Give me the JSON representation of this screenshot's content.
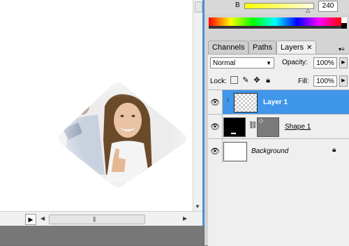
{
  "color_panel": {
    "channel_label": "B",
    "channel_value": "240",
    "colors": {
      "slider_start": "#ffff00",
      "slider_end": "#ffffe0"
    }
  },
  "tabs": [
    {
      "label": "Channels"
    },
    {
      "label": "Paths"
    },
    {
      "label": "Layers"
    }
  ],
  "tab_close": "✕",
  "layers_panel": {
    "blend_mode": "Normal",
    "opacity_label": "Opacity:",
    "opacity_value": "100%",
    "lock_label": "Lock:",
    "fill_label": "Fill:",
    "fill_value": "100%",
    "layers": [
      {
        "name": "Layer 1",
        "selected": true,
        "clipped": true
      },
      {
        "name": "Shape 1",
        "selected": false
      },
      {
        "name": "Background",
        "selected": false,
        "locked": true
      }
    ]
  },
  "colors": {
    "selection": "#3f96ea",
    "window_border": "#4d8fd6",
    "workspace": "#6e6e6e"
  },
  "icons": [
    "eye-icon",
    "link-icon",
    "lock-icon",
    "move-icon",
    "brush-icon",
    "transparency-lock-icon",
    "clip-arrow-icon"
  ]
}
